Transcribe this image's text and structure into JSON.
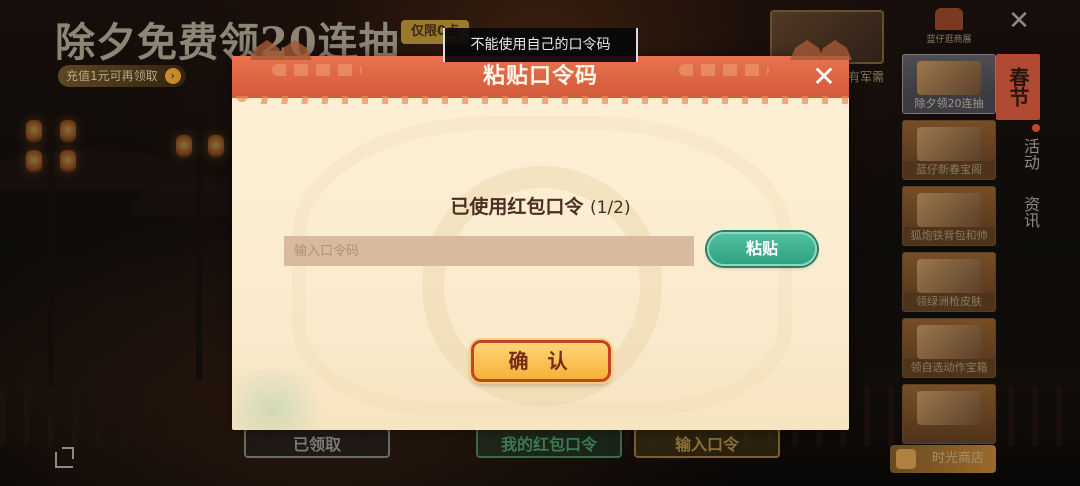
{
  "background": {
    "banner_title": "除夕免费领20连抽",
    "limited_badge": "仅限0点",
    "recharge_text": "充值1元可再领取",
    "shop_label": "蓝仔逛商展",
    "right_edge_text": "有军需"
  },
  "sidebar": {
    "events": [
      {
        "label": "除夕领20连抽",
        "active": true
      },
      {
        "label": "蓝仔新春宝阁",
        "active": false
      },
      {
        "label": "狐炮铁背包和帅",
        "active": false
      },
      {
        "label": "领绿洲枪皮肤",
        "active": false
      },
      {
        "label": "领自选动作宝箱",
        "active": false
      },
      {
        "label": "",
        "active": false
      }
    ],
    "tabs": [
      {
        "label": "春节",
        "active": true
      },
      {
        "label": "活动",
        "active": false
      },
      {
        "label": "资讯",
        "active": false
      }
    ],
    "time_shop_label": "时光商店"
  },
  "bottom_tabs": {
    "claimed": "已领取",
    "my_red_packet_code": "我的红包口令",
    "enter_code": "输入口令"
  },
  "toast": {
    "message": "不能使用自己的口令码"
  },
  "dialog": {
    "title": "粘贴口令码",
    "used_label": "已使用红包口令",
    "used_count": "(1/2)",
    "input_value": "",
    "input_placeholder": "输入口令码",
    "paste_label": "粘贴",
    "confirm_label": "确 认"
  },
  "colors": {
    "header_accent": "#d35a3a",
    "paste_button": "#2fa282",
    "confirm_button": "#f5b23a",
    "dialog_body": "#fbecd0"
  },
  "icons": {
    "close": "close-icon",
    "share": "share-icon",
    "bag": "bag-icon"
  }
}
